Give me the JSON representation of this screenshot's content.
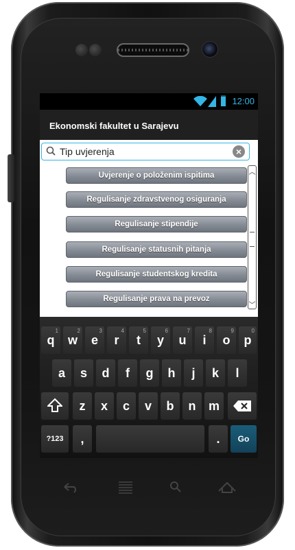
{
  "status_bar": {
    "time": "12:00"
  },
  "app_bar": {
    "title": "Ekonomski fakultet u Sarajevu"
  },
  "search": {
    "label": "Tip uvjerenja"
  },
  "list": {
    "items": [
      "Uvjerenje o položenim ispitima",
      "Regulisanje zdravstvenog osiguranja",
      "Regulisanje stipendije",
      "Regulisanje statusnih pitanja",
      "Regulisanje studentskog kredita",
      "Regulisanje prava na prevoz"
    ]
  },
  "keyboard": {
    "row1": [
      {
        "key": "q",
        "alt": "1"
      },
      {
        "key": "w",
        "alt": "2"
      },
      {
        "key": "e",
        "alt": "3"
      },
      {
        "key": "r",
        "alt": "4"
      },
      {
        "key": "t",
        "alt": "5"
      },
      {
        "key": "y",
        "alt": "6"
      },
      {
        "key": "u",
        "alt": "7"
      },
      {
        "key": "i",
        "alt": "8"
      },
      {
        "key": "o",
        "alt": "9"
      },
      {
        "key": "p",
        "alt": "0"
      }
    ],
    "row2": [
      "a",
      "s",
      "d",
      "f",
      "g",
      "h",
      "j",
      "k",
      "l"
    ],
    "row3": [
      "z",
      "x",
      "c",
      "v",
      "b",
      "n",
      "m"
    ],
    "symbols_key": "?123",
    "comma_key": ",",
    "period_key": ".",
    "go_key": "Go"
  },
  "colors": {
    "accent": "#33b5e5",
    "list_button": "#858b94",
    "go_key": "#1b5d7a"
  },
  "icons": [
    "wifi-icon",
    "signal-icon",
    "battery-icon",
    "search-icon",
    "clear-icon",
    "shift-icon",
    "backspace-icon",
    "back-icon",
    "home-icon",
    "recents-icon",
    "search-nav-icon"
  ]
}
